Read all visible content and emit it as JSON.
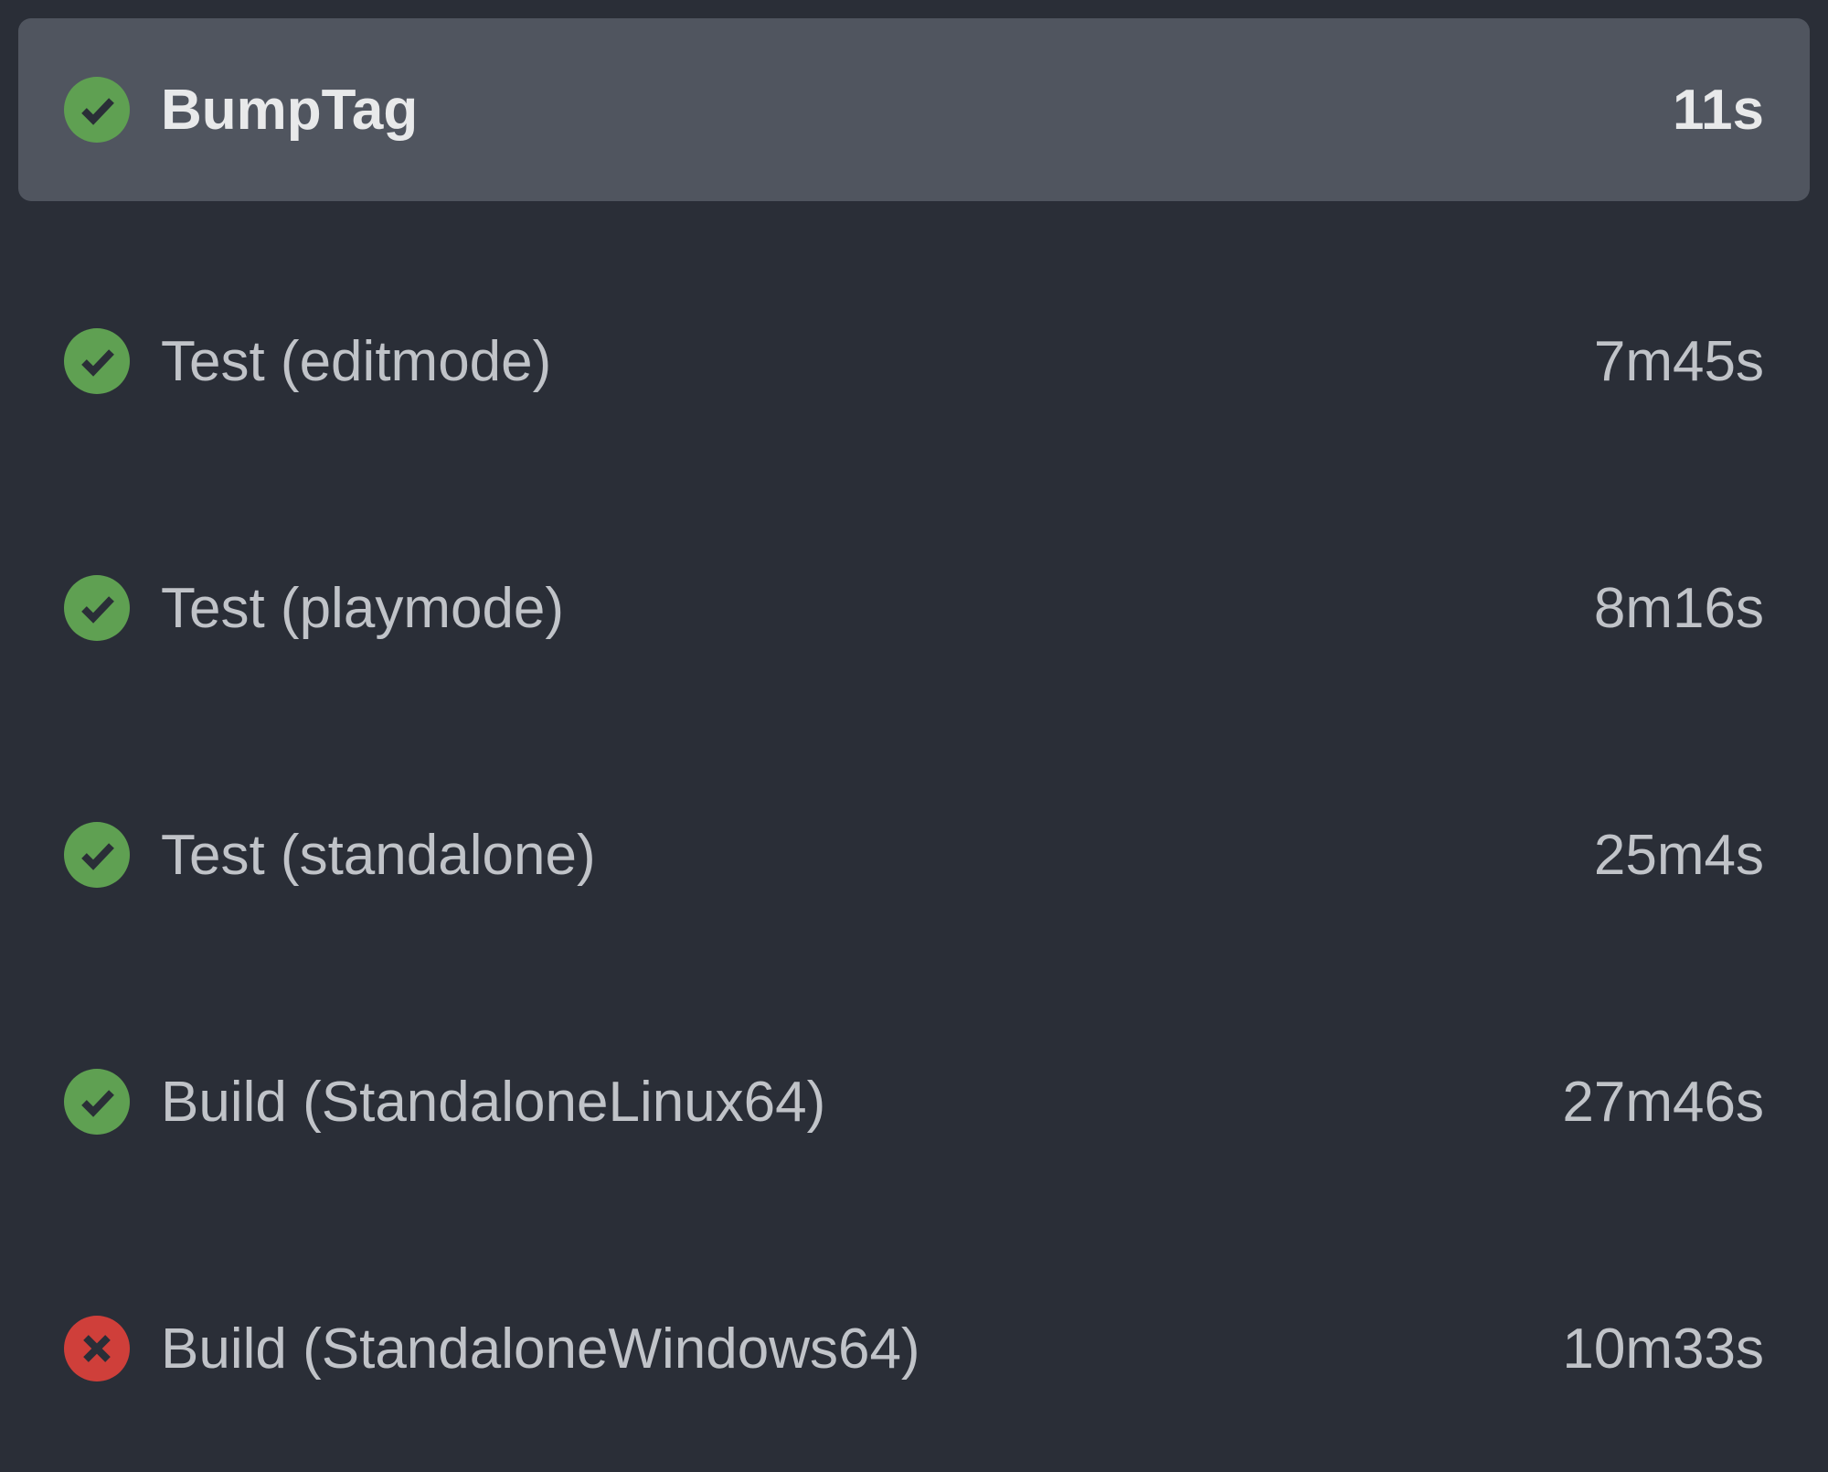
{
  "jobs": [
    {
      "name": "BumpTag",
      "duration": "11s",
      "status": "success",
      "selected": true
    },
    {
      "name": "Test (editmode)",
      "duration": "7m45s",
      "status": "success",
      "selected": false
    },
    {
      "name": "Test (playmode)",
      "duration": "8m16s",
      "status": "success",
      "selected": false
    },
    {
      "name": "Test (standalone)",
      "duration": "25m4s",
      "status": "success",
      "selected": false
    },
    {
      "name": "Build (StandaloneLinux64)",
      "duration": "27m46s",
      "status": "success",
      "selected": false
    },
    {
      "name": "Build (StandaloneWindows64)",
      "duration": "10m33s",
      "status": "failure",
      "selected": false
    }
  ],
  "colors": {
    "success": "#5fa052",
    "failure": "#cf3f3a",
    "background": "#2a2e37",
    "selectedBg": "#50555f"
  }
}
